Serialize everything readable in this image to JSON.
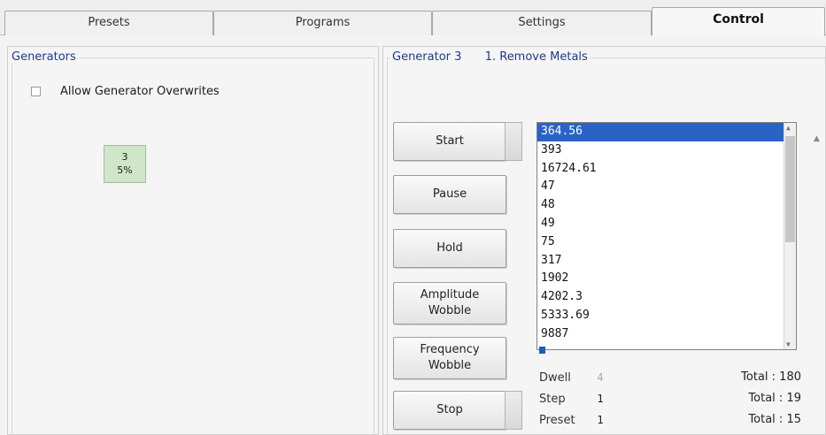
{
  "tabs": [
    {
      "label": "Presets"
    },
    {
      "label": "Programs"
    },
    {
      "label": "Settings"
    },
    {
      "label": "Control"
    }
  ],
  "active_tab": "Control",
  "generators_panel": {
    "title": "Generators",
    "allow_overwrites_label": "Allow Generator Overwrites",
    "allow_overwrites_checked": false,
    "tile": {
      "number": "3",
      "percent": "5%"
    }
  },
  "generator_panel": {
    "generator_label": "Generator 3",
    "program_label": "1. Remove Metals"
  },
  "buttons": {
    "start": "Start",
    "pause": "Pause",
    "hold": "Hold",
    "amplitude_wobble": "Amplitude Wobble",
    "frequency_wobble": "Frequency Wobble",
    "stop": "Stop"
  },
  "frequency_list": {
    "items": [
      "364.56",
      "393",
      "16724.61",
      "47",
      "48",
      "49",
      "75",
      "317",
      "1902",
      "4202.3",
      "5333.69",
      "9887"
    ],
    "selected": "364.56"
  },
  "stats": {
    "dwell": {
      "label": "Dwell",
      "value": "4",
      "total": "Total : 180"
    },
    "step": {
      "label": "Step",
      "value": "1",
      "total": "Total : 19"
    },
    "preset": {
      "label": "Preset",
      "value": "1",
      "total": "Total : 15"
    }
  },
  "colors": {
    "selection": "#2a63c6",
    "tile": "#cfe7c8",
    "legend_text": "#1f3a8a"
  }
}
